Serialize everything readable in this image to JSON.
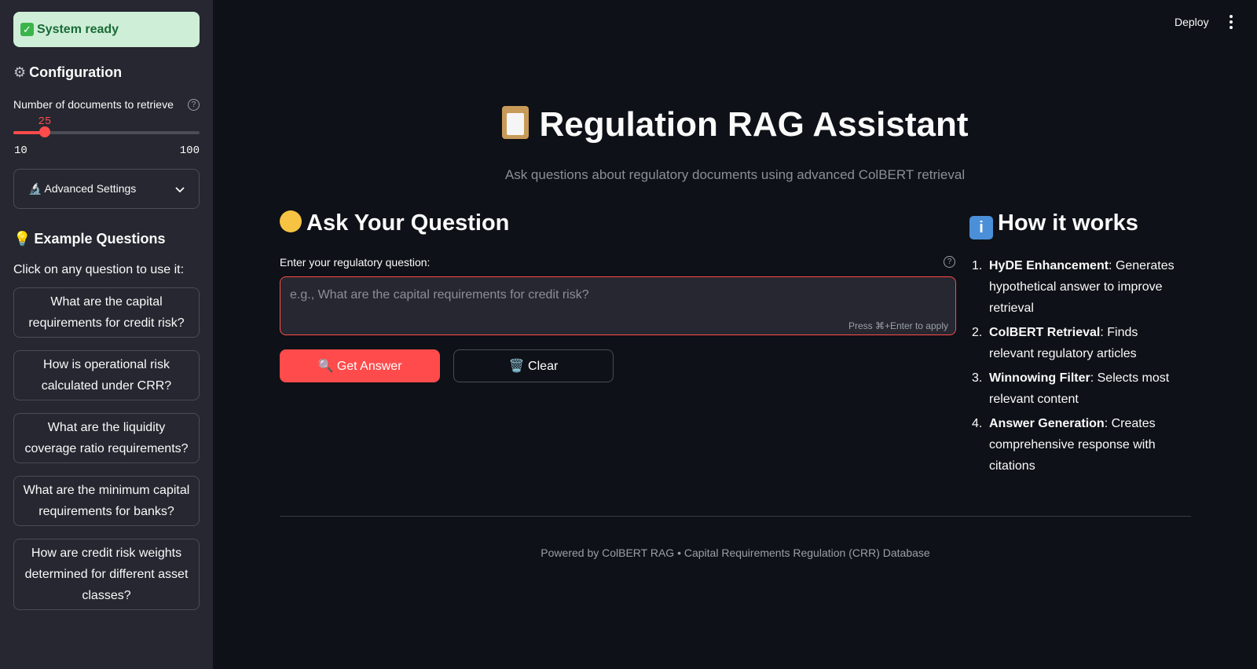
{
  "sidebar": {
    "status": "System ready",
    "config_heading": "Configuration",
    "slider": {
      "label": "Number of documents to retrieve",
      "value": "25",
      "min": "10",
      "max": "100",
      "fraction": 0.1667
    },
    "advanced_label": "🔬 Advanced Settings",
    "examples_heading": "Example Questions",
    "examples_sub": "Click on any question to use it:",
    "examples": [
      "What are the capital requirements for credit risk?",
      "How is operational risk calculated under CRR?",
      "What are the liquidity coverage ratio requirements?",
      "What are the minimum capital requirements for banks?",
      "How are credit risk weights determined for different asset classes?"
    ]
  },
  "topbar": {
    "deploy": "Deploy"
  },
  "main": {
    "title": "Regulation RAG Assistant",
    "subtitle": "Ask questions about regulatory documents using advanced ColBERT retrieval",
    "ask_heading": "Ask Your Question",
    "question_label": "Enter your regulatory question:",
    "question_placeholder": "e.g., What are the capital requirements for credit risk?",
    "question_value": "",
    "hint": "Press ⌘+Enter to apply",
    "get_answer": "🔍 Get Answer",
    "clear": "🗑️ Clear"
  },
  "how": {
    "heading": "How it works",
    "steps": [
      {
        "num": "1.",
        "title": "HyDE Enhancement",
        "desc": ": Generates hypothetical answer to improve retrieval"
      },
      {
        "num": "2.",
        "title": "ColBERT Retrieval",
        "desc": ": Finds relevant regulatory articles"
      },
      {
        "num": "3.",
        "title": "Winnowing Filter",
        "desc": ": Selects most relevant content"
      },
      {
        "num": "4.",
        "title": "Answer Generation",
        "desc": ": Creates comprehensive response with citations"
      }
    ]
  },
  "footer": "Powered by ColBERT RAG • Capital Requirements Regulation (CRR) Database",
  "colors": {
    "accent": "#ff4b4b",
    "background": "#0e1117",
    "sidebar": "#262730",
    "status_bg": "#cfeed8"
  }
}
